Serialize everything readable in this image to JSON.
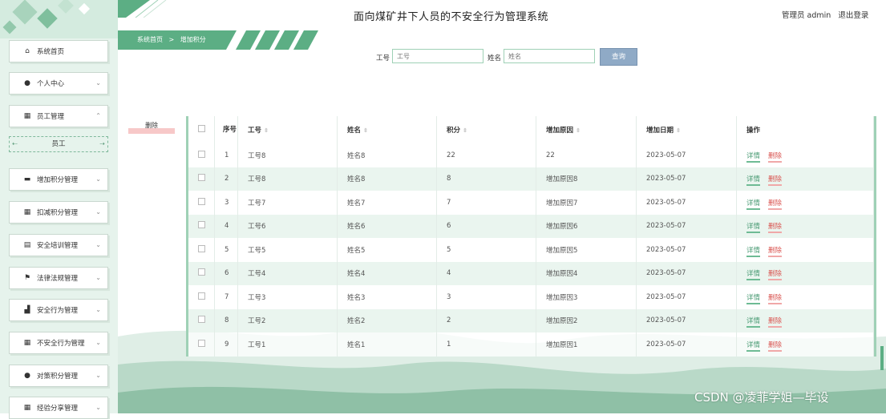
{
  "header": {
    "title": "面向煤矿井下人员的不安全行为管理系统",
    "user_label": "管理员 admin",
    "logout_label": "退出登录"
  },
  "breadcrumb": {
    "home": "系统首页",
    "separator": ">",
    "current": "增加积分"
  },
  "search": {
    "emp_no_label": "工号",
    "emp_no_placeholder": "工号",
    "name_label": "姓名",
    "name_placeholder": "姓名",
    "button_label": "查询"
  },
  "delete_button": "删除",
  "sidebar": {
    "items": [
      {
        "label": "系统首页",
        "icon": "home-icon",
        "chevron": false
      },
      {
        "label": "个人中心",
        "icon": "user-icon",
        "chevron": true
      },
      {
        "label": "员工管理",
        "icon": "grid-icon",
        "chevron": true,
        "expanded": true
      },
      {
        "label": "员工",
        "sub": true
      },
      {
        "label": "增加积分管理",
        "icon": "briefcase-icon",
        "chevron": true
      },
      {
        "label": "扣减积分管理",
        "icon": "grid-icon",
        "chevron": true
      },
      {
        "label": "安全培训管理",
        "icon": "clipboard-icon",
        "chevron": true
      },
      {
        "label": "法律法规管理",
        "icon": "flag-icon",
        "chevron": true
      },
      {
        "label": "安全行为管理",
        "icon": "thumbs-up-icon",
        "chevron": true
      },
      {
        "label": "不安全行为管理",
        "icon": "grid-icon",
        "chevron": true
      },
      {
        "label": "对策积分管理",
        "icon": "user-icon",
        "chevron": true
      },
      {
        "label": "经验分享管理",
        "icon": "grid-icon",
        "chevron": true
      }
    ]
  },
  "table": {
    "columns": [
      "序号",
      "工号",
      "姓名",
      "积分",
      "增加原因",
      "增加日期",
      "操作"
    ],
    "actions": {
      "detail": "详情",
      "delete": "删除"
    },
    "rows": [
      {
        "no": "1",
        "emp_no": "工号8",
        "name": "姓名8",
        "points": "22",
        "reason": "22",
        "date": "2023-05-07"
      },
      {
        "no": "2",
        "emp_no": "工号8",
        "name": "姓名8",
        "points": "8",
        "reason": "增加原因8",
        "date": "2023-05-07"
      },
      {
        "no": "3",
        "emp_no": "工号7",
        "name": "姓名7",
        "points": "7",
        "reason": "增加原因7",
        "date": "2023-05-07"
      },
      {
        "no": "4",
        "emp_no": "工号6",
        "name": "姓名6",
        "points": "6",
        "reason": "增加原因6",
        "date": "2023-05-07"
      },
      {
        "no": "5",
        "emp_no": "工号5",
        "name": "姓名5",
        "points": "5",
        "reason": "增加原因5",
        "date": "2023-05-07"
      },
      {
        "no": "6",
        "emp_no": "工号4",
        "name": "姓名4",
        "points": "4",
        "reason": "增加原因4",
        "date": "2023-05-07"
      },
      {
        "no": "7",
        "emp_no": "工号3",
        "name": "姓名3",
        "points": "3",
        "reason": "增加原因3",
        "date": "2023-05-07"
      },
      {
        "no": "8",
        "emp_no": "工号2",
        "name": "姓名2",
        "points": "2",
        "reason": "增加原因2",
        "date": "2023-05-07"
      },
      {
        "no": "9",
        "emp_no": "工号1",
        "name": "姓名1",
        "points": "1",
        "reason": "增加原因1",
        "date": "2023-05-07"
      }
    ]
  },
  "watermark": "CSDN @凌菲学姐—毕设",
  "colors": {
    "accent": "#5cae84",
    "sidebar_bg": "#e6f3ec",
    "row_alt": "#eaf5ef",
    "search_button": "#8faac6",
    "delete": "#d9534f"
  }
}
